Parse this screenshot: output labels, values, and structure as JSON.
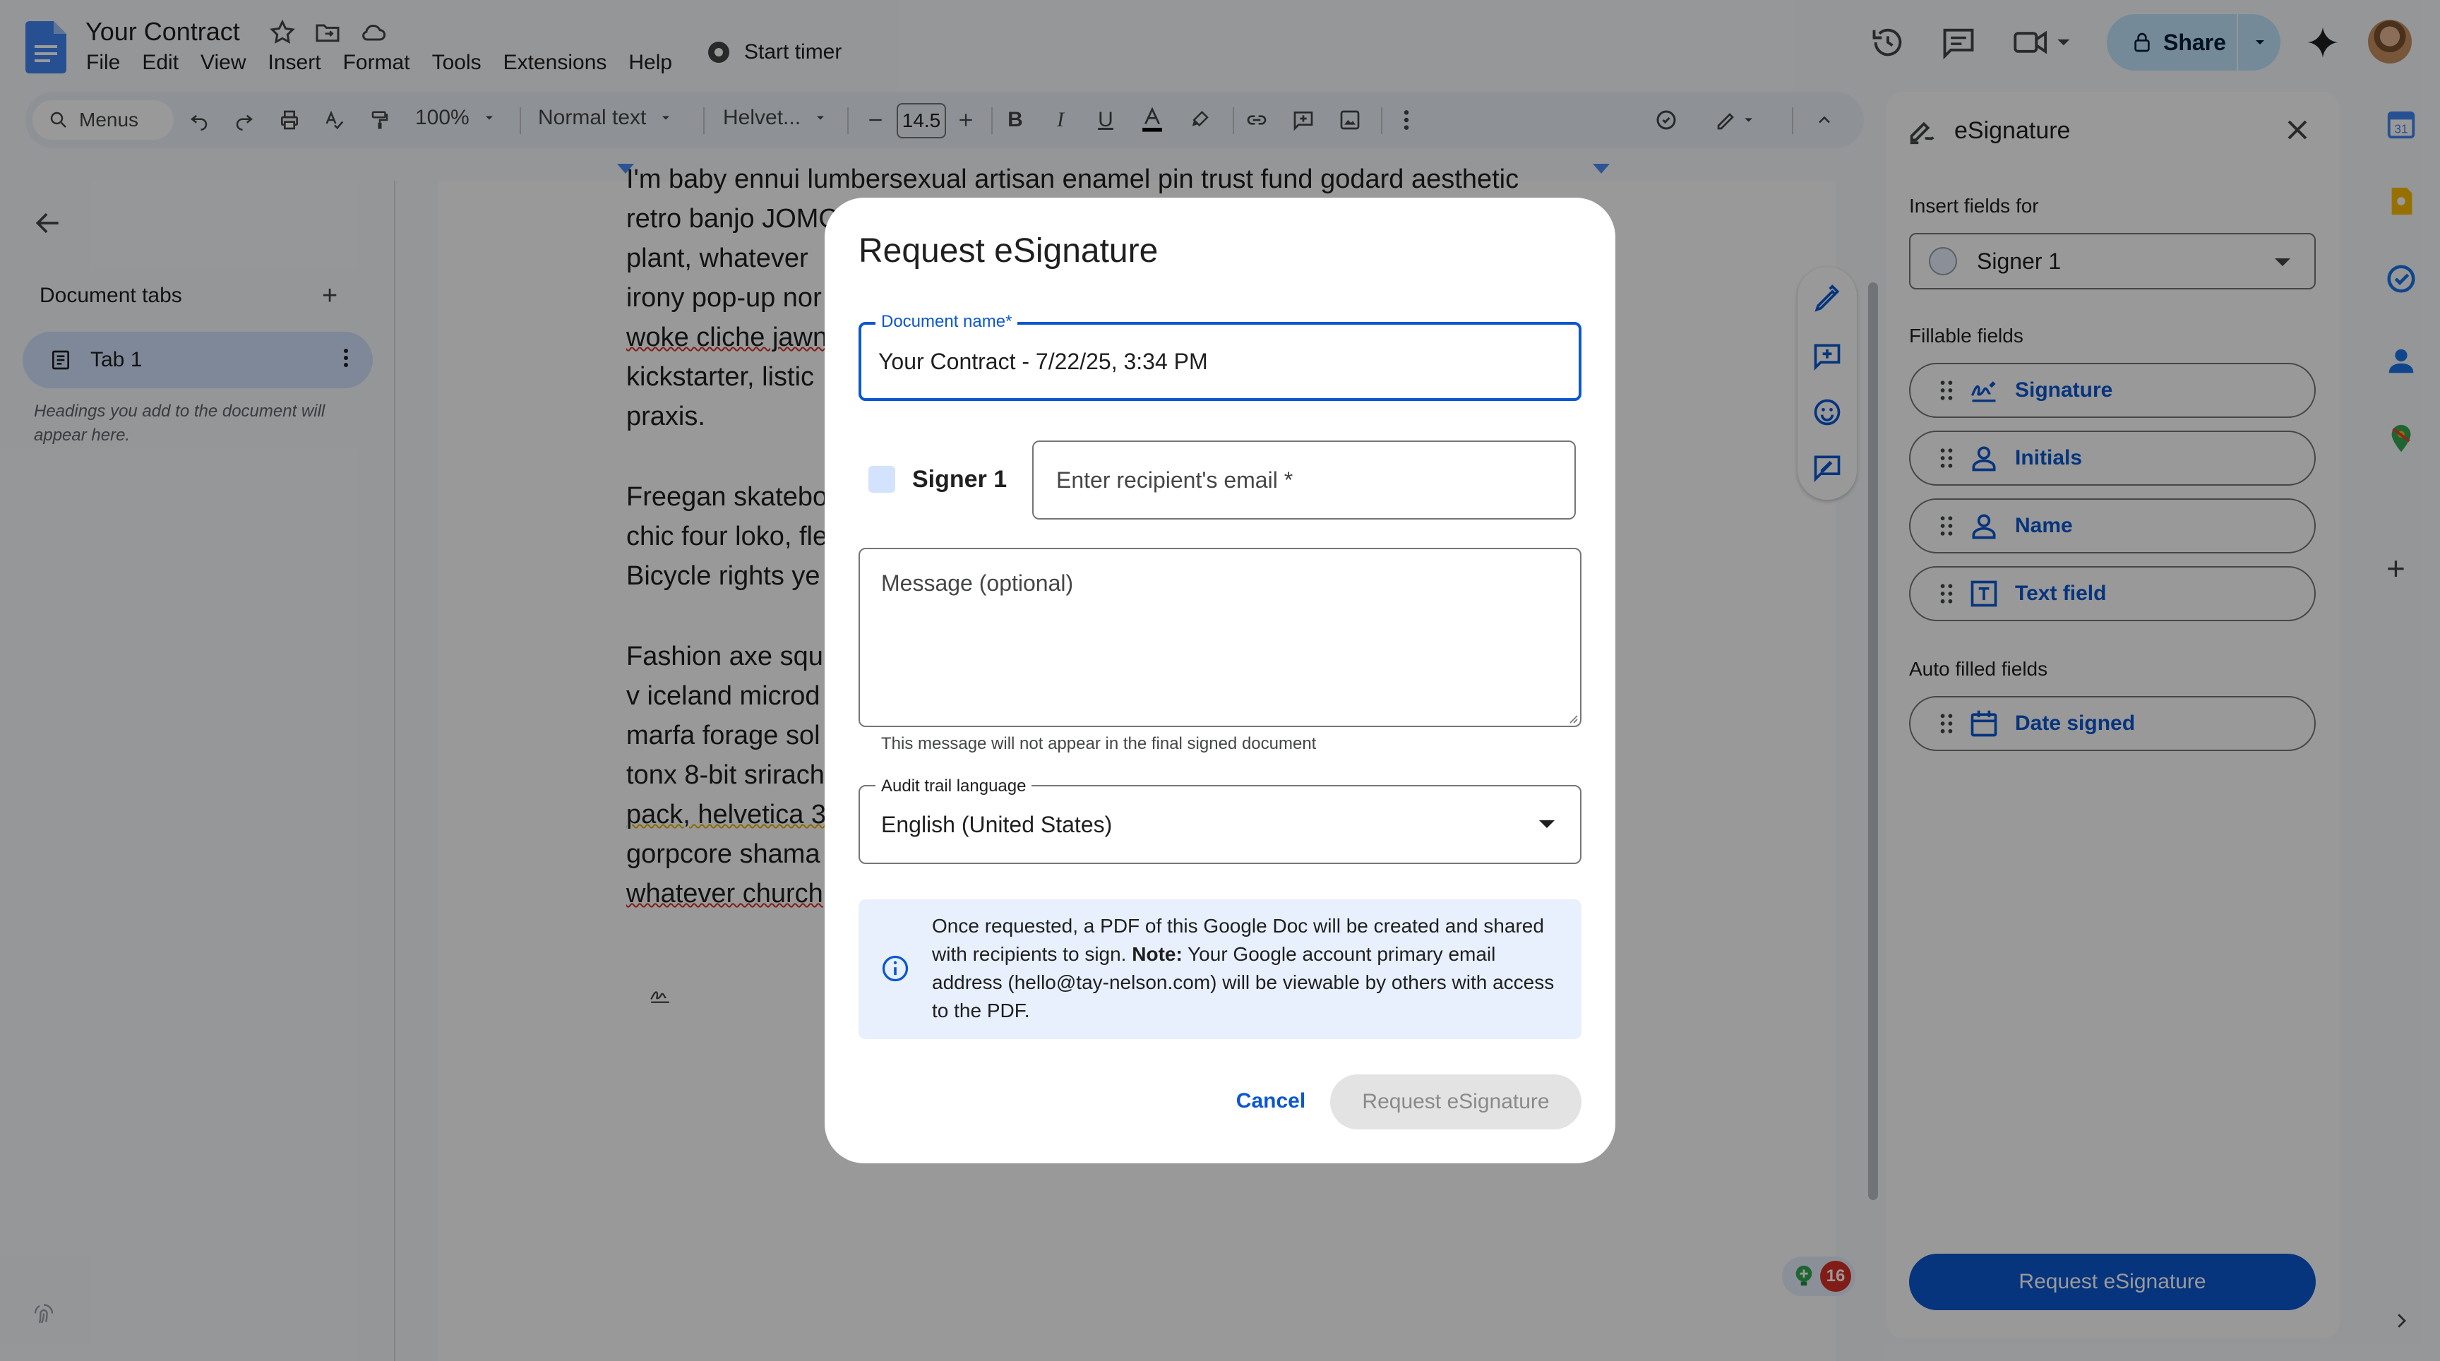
{
  "app": {
    "doc_title": "Your Contract",
    "menu": [
      "File",
      "Edit",
      "View",
      "Insert",
      "Format",
      "Tools",
      "Extensions",
      "Help"
    ],
    "timer_label": "Start timer",
    "share_label": "Share"
  },
  "toolbar": {
    "search_label": "Menus",
    "zoom": "100%",
    "style": "Normal text",
    "font": "Helvet...",
    "font_size": "14.5"
  },
  "left_panel": {
    "title": "Document tabs",
    "tab_label": "Tab 1",
    "hint": "Headings you add to the document will appear here."
  },
  "document": {
    "paragraphs": [
      "I'm baby ennui lumbersexual artisan enamel pin trust fund godard aesthetic retro banjo JOMO plant, whatever irony pop-up woke cliche jawn kickstarter, listic praxis.",
      "Freegan skatebo chic four loko, fle Bicycle rights ye",
      "Fashion axe squ v iceland microd marfa forage sol tonx 8-bit srirach pack, helvetica 3 gorpcore shama whatever church"
    ],
    "lines": [
      "I'm baby ennui lumbersexual artisan enamel pin trust fund godard aesthetic",
      "retro banjo JOMO",
      "plant, whatever",
      "irony pop-up nor",
      "woke cliche jawn",
      "kickstarter, listic",
      "praxis.",
      "",
      "Freegan skatebo",
      "chic four loko, fle",
      "Bicycle rights ye",
      "",
      "Fashion axe squ",
      "v iceland microd",
      "marfa forage sol",
      "tonx 8-bit srirach",
      "pack, helvetica 3",
      "gorpcore shama",
      "whatever church"
    ]
  },
  "badge_count": "16",
  "esig_panel": {
    "title": "eSignature",
    "insert_for_label": "Insert fields for",
    "signer_selected": "Signer 1",
    "fillable_label": "Fillable fields",
    "fields": [
      {
        "label": "Signature",
        "icon": "signature-icon"
      },
      {
        "label": "Initials",
        "icon": "person-icon"
      },
      {
        "label": "Name",
        "icon": "person-icon"
      },
      {
        "label": "Text field",
        "icon": "text-field-icon"
      }
    ],
    "auto_label": "Auto filled fields",
    "auto_fields": [
      {
        "label": "Date signed",
        "icon": "calendar-icon"
      }
    ],
    "request_label": "Request eSignature"
  },
  "dialog": {
    "title": "Request eSignature",
    "doc_name_label": "Document name*",
    "doc_name_value": "Your Contract - 7/22/25, 3:34 PM",
    "signer_label": "Signer 1",
    "email_placeholder": "Enter recipient's email *",
    "message_placeholder": "Message (optional)",
    "message_hint": "This message will not appear in the final signed document",
    "audit_label": "Audit trail language",
    "audit_value": "English (United States)",
    "info_pre": "Once requested, a PDF of this Google Doc will be created and shared with recipients to sign. ",
    "info_note": "Note:",
    "info_post": " Your Google account primary email address (hello@tay-nelson.com) will be viewable by others with access to the PDF.",
    "cancel_label": "Cancel",
    "request_label": "Request eSignature"
  },
  "colors": {
    "accent": "#0b57d0",
    "share_bg": "#c2e7ff",
    "tab_bg": "#d3e3fd",
    "info_bg": "#e8f0fe"
  }
}
